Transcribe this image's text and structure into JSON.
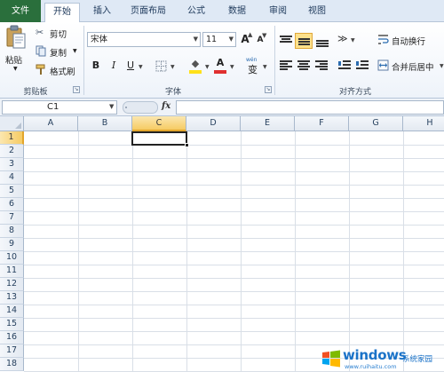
{
  "tabs": [
    {
      "label": "文件"
    },
    {
      "label": "开始"
    },
    {
      "label": "插入"
    },
    {
      "label": "页面布局"
    },
    {
      "label": "公式"
    },
    {
      "label": "数据"
    },
    {
      "label": "审阅"
    },
    {
      "label": "视图"
    }
  ],
  "clipboard": {
    "paste_label": "粘贴",
    "cut_label": "剪切",
    "copy_label": "复制",
    "format_painter_label": "格式刷",
    "group_label": "剪贴板"
  },
  "font": {
    "name_value": "宋体",
    "size_value": "11",
    "grow_label": "A",
    "shrink_label": "A",
    "bold_label": "B",
    "italic_label": "I",
    "underline_label": "U",
    "fill_color_label": "◆",
    "font_color_label": "A",
    "phonetic_top": "wén",
    "phonetic_bottom": "变",
    "group_label": "字体",
    "font_color_hex": "#e03030",
    "fill_color_hex": "#ffe11a"
  },
  "alignment": {
    "wrap_text_label": "自动换行",
    "merge_center_label": "合并后居中",
    "group_label": "对齐方式"
  },
  "formula_bar": {
    "name_box_value": "C1",
    "fx_label": "fx"
  },
  "grid": {
    "columns": [
      "A",
      "B",
      "C",
      "D",
      "E",
      "F",
      "G",
      "H"
    ],
    "rows": [
      "1",
      "2",
      "3",
      "4",
      "5",
      "6",
      "7",
      "8",
      "9",
      "10",
      "11",
      "12",
      "13",
      "14",
      "15",
      "16",
      "17",
      "18"
    ],
    "selected_column": "C",
    "selected_row": "1"
  },
  "watermark": {
    "title": "windows",
    "subtitle": "系统家园",
    "url": "www.ruihaitu.com"
  }
}
